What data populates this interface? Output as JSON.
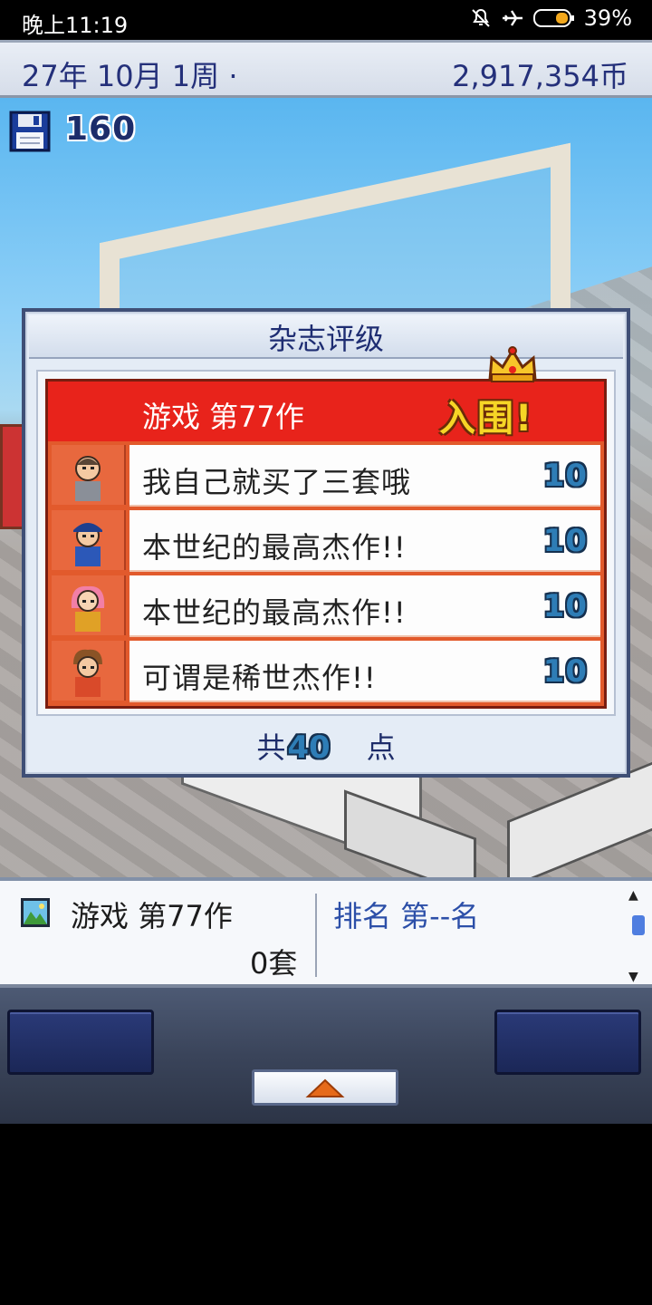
{
  "status_bar": {
    "time": "晚上11:19",
    "battery": "39%",
    "icons": [
      "mute-bell-icon",
      "airplane-icon",
      "battery-icon"
    ]
  },
  "header": {
    "date": "27年 10月 1周 ·",
    "money": "2,917,354币"
  },
  "scene": {
    "save_count": "160",
    "save_icon": "floppy-disk-icon"
  },
  "dialog": {
    "title": "杂志评级",
    "game_title": "游戏 第77作",
    "status": "入围!",
    "crown_icon": "crown-icon",
    "reviews": [
      {
        "comment": "我自己就买了三套哦",
        "score": "10",
        "avatar": "reviewer-bald-icon"
      },
      {
        "comment": "本世纪的最高杰作!!",
        "score": "10",
        "avatar": "reviewer-cap-icon"
      },
      {
        "comment": "本世纪的最高杰作!!",
        "score": "10",
        "avatar": "reviewer-pink-hair-icon"
      },
      {
        "comment": "可谓是稀世杰作!!",
        "score": "10",
        "avatar": "reviewer-brown-hair-icon"
      }
    ],
    "total_prefix": "共",
    "total_value": "40",
    "total_suffix": "点"
  },
  "info_panel": {
    "title": "游戏 第77作",
    "sales": "0套",
    "rank": "排名 第--名"
  },
  "colors": {
    "header_red": "#e8231b",
    "score_blue": "#2e7db6",
    "title_navy": "#1e2d72"
  }
}
